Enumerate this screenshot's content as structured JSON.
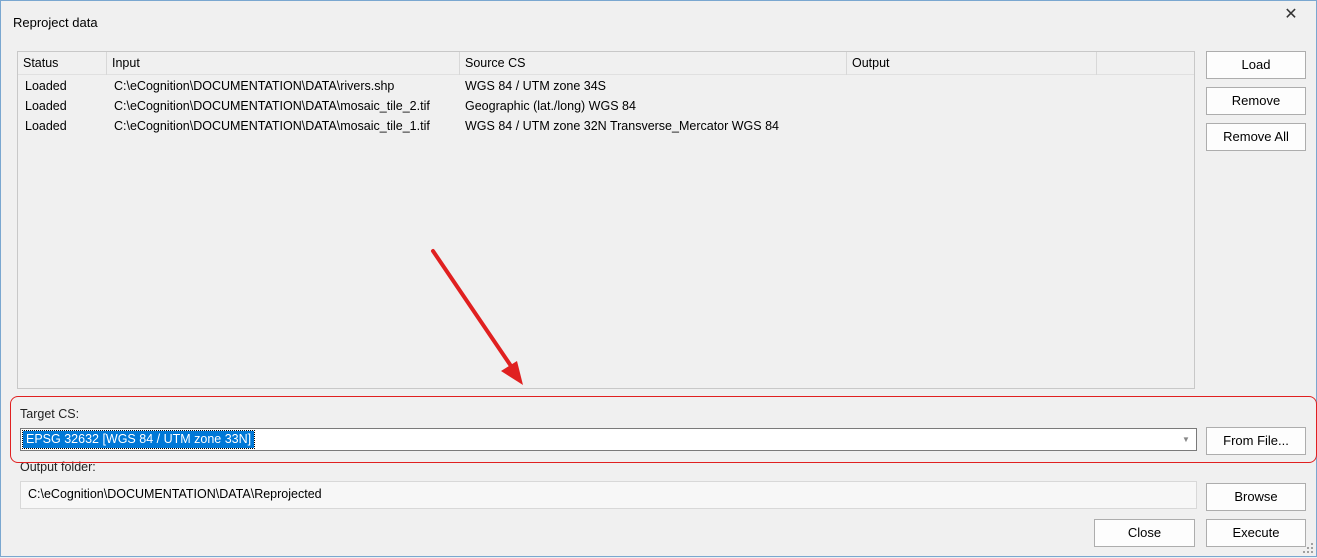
{
  "window": {
    "title": "Reproject data",
    "close_glyph": "✕"
  },
  "table": {
    "columns": [
      "Status",
      "Input",
      "Source CS",
      "Output"
    ],
    "rows": [
      {
        "status": "Loaded",
        "input": "C:\\eCognition\\DOCUMENTATION\\DATA\\rivers.shp",
        "source_cs": "WGS 84 / UTM zone 34S",
        "output": ""
      },
      {
        "status": "Loaded",
        "input": "C:\\eCognition\\DOCUMENTATION\\DATA\\mosaic_tile_2.tif",
        "source_cs": "Geographic (lat./long) WGS 84",
        "output": ""
      },
      {
        "status": "Loaded",
        "input": "C:\\eCognition\\DOCUMENTATION\\DATA\\mosaic_tile_1.tif",
        "source_cs": "WGS 84 / UTM zone 32N Transverse_Mercator WGS 84",
        "output": ""
      }
    ]
  },
  "buttons": {
    "load": "Load",
    "remove": "Remove",
    "remove_all": "Remove All",
    "from_file": "From File...",
    "browse": "Browse",
    "close": "Close",
    "execute": "Execute"
  },
  "target_cs": {
    "label": "Target CS:",
    "selected": "EPSG 32632 [WGS 84 / UTM zone 33N]"
  },
  "output_folder": {
    "label": "Output folder:",
    "value": "C:\\eCognition\\DOCUMENTATION\\DATA\\Reprojected"
  },
  "annotation": {
    "color": "#e02020"
  },
  "icons": {
    "dropdown": "chevron-down-icon",
    "close": "close-icon",
    "grip": "resize-grip-icon"
  }
}
